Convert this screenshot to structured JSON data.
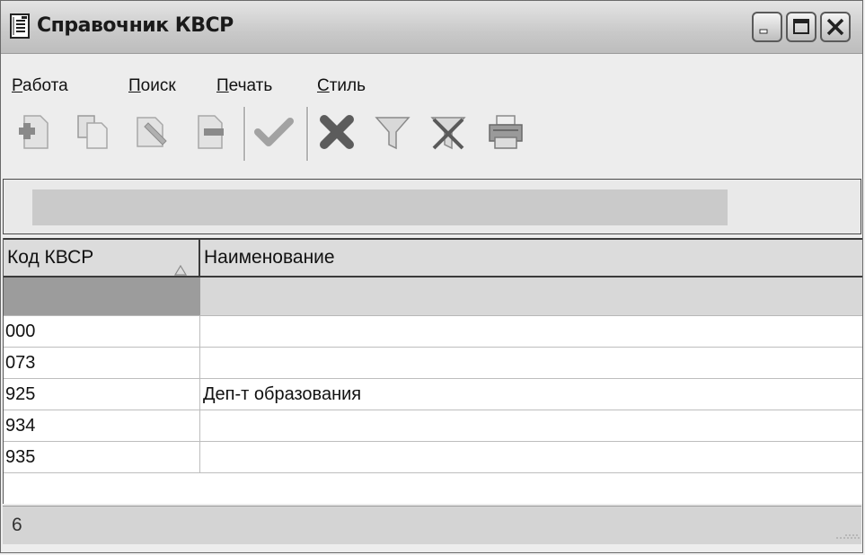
{
  "window": {
    "title": "Справочник КВСР",
    "icons": {
      "app": "document-icon",
      "minimize": "minimize-icon",
      "maximize": "maximize-icon",
      "close": "close-icon"
    }
  },
  "menu": [
    {
      "label_underlined": "Р",
      "label_rest": "абота"
    },
    {
      "label_underlined": "П",
      "label_rest": "оиск"
    },
    {
      "label_underlined": "П",
      "label_rest": "ечать"
    },
    {
      "label_underlined": "С",
      "label_rest": "тиль"
    }
  ],
  "toolbar": {
    "buttons": [
      "add-icon",
      "copy-icon",
      "edit-icon",
      "delete-icon",
      "apply-check-icon",
      "cancel-x-icon",
      "filter-icon",
      "clear-filter-icon",
      "print-icon"
    ]
  },
  "grid": {
    "columns": [
      {
        "label": "Код КВСР",
        "sort": "ascending"
      },
      {
        "label": "Наименование"
      }
    ],
    "rows": [
      {
        "code": "000",
        "name": ""
      },
      {
        "code": "073",
        "name": ""
      },
      {
        "code": "925",
        "name": "Деп-т образования"
      },
      {
        "code": "934",
        "name": ""
      },
      {
        "code": "935",
        "name": ""
      }
    ]
  },
  "status": {
    "count": "6"
  },
  "colors": {
    "title_bg": "#c9c9c9",
    "window_bg": "#ededed",
    "grid_bg": "#ffffff",
    "header_bg": "#dcdcdc",
    "filter_cell_dark": "#9c9c9c",
    "status_bg": "#d4d4d4"
  }
}
